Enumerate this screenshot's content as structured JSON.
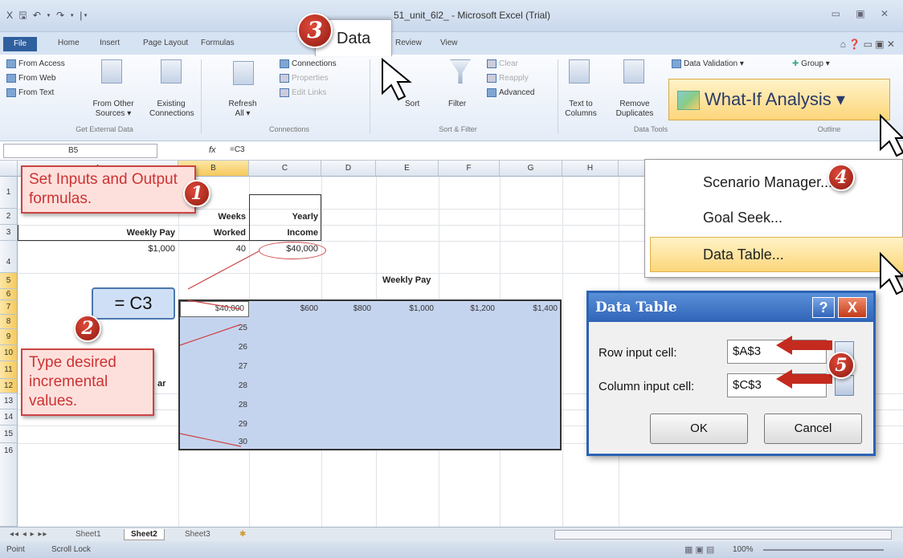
{
  "window": {
    "title": "51_unit_6l2_ - Microsoft Excel (Trial)",
    "qat": "X 🖫 ↶ ▾ ↷ ▾ |▾",
    "controls": "▭ ▣ ✕"
  },
  "tabs": {
    "file": "File",
    "items": [
      "Home",
      "Insert",
      "Page Layout",
      "Formulas",
      "Data",
      "Review",
      "View"
    ],
    "active": "Data",
    "right_icons": "⌂ ❓ ▭ ▣ ✕"
  },
  "ribbon": {
    "get_external": {
      "from_access": "From Access",
      "from_web": "From Web",
      "from_text": "From Text",
      "from_other": "From Other Sources ▾",
      "existing": "Existing Connections",
      "label": "Get External Data"
    },
    "connections": {
      "refresh": "Refresh All ▾",
      "connections": "Connections",
      "properties": "Properties",
      "edit_links": "Edit Links",
      "label": "Connections"
    },
    "sort_filter": {
      "sort": "Sort",
      "filter": "Filter",
      "clear": "Clear",
      "reapply": "Reapply",
      "advanced": "Advanced",
      "label": "Sort & Filter"
    },
    "data_tools": {
      "text_to_columns": "Text to Columns",
      "remove_duplicates": "Remove Duplicates",
      "data_validation": "Data Validation ▾",
      "label": "Data Tools"
    },
    "outline": {
      "group": "Group ▾",
      "label": "Outline"
    },
    "what_if": "What-If Analysis ▾"
  },
  "formula_bar": {
    "name_box": "B5",
    "fx": "fx",
    "formula": "=C3"
  },
  "columns": [
    "A",
    "B",
    "C",
    "D",
    "E",
    "F",
    "G",
    "H"
  ],
  "rows": [
    "1",
    "2",
    "3",
    "4",
    "5",
    "6",
    "7",
    "8",
    "9",
    "10",
    "11",
    "12",
    "13",
    "14",
    "15",
    "16"
  ],
  "cells": {
    "b1": "Weeks",
    "c1": "Yearly",
    "a2": "Weekly Pay",
    "b2": "Worked",
    "c2": "Income",
    "a3": "$1,000",
    "b3": "40",
    "c3": "$40,000",
    "e4": "Weekly Pay",
    "a9_partial": "ar",
    "table_corner": "$40,000",
    "row_headers": [
      "$600",
      "$800",
      "$1,000",
      "$1,200",
      "$1,400"
    ],
    "col_values": [
      "25",
      "26",
      "27",
      "28",
      "28",
      "29",
      "30"
    ]
  },
  "callouts": {
    "step1": "Set Inputs and Output formulas.",
    "step2": "Type desired incremental values.",
    "c3_label": "= C3",
    "badges": [
      "1",
      "2",
      "3",
      "4",
      "5"
    ]
  },
  "menu": {
    "scenario": "Scenario Manager...",
    "goal_seek": "Goal Seek...",
    "data_table": "Data Table..."
  },
  "dialog": {
    "title": "Data Table",
    "help": "?",
    "close": "X",
    "row_label": "Row input cell:",
    "row_value": "$A$3",
    "col_label": "Column input cell:",
    "col_value": "$C$3",
    "ok": "OK",
    "cancel": "Cancel"
  },
  "sheets": {
    "nav": "◂◂ ◂ ▸ ▸▸",
    "items": [
      "Sheet1",
      "Sheet2",
      "Sheet3"
    ],
    "active": "Sheet2"
  },
  "status": {
    "mode": "Point",
    "scroll": "Scroll Lock",
    "zoom": "100%"
  }
}
